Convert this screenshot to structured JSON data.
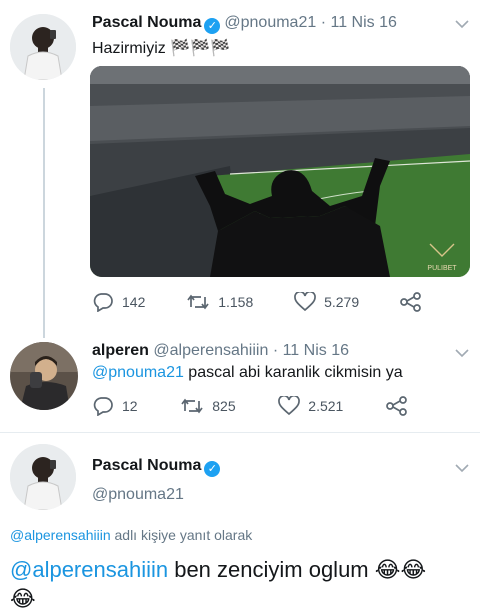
{
  "tweet1": {
    "name": "Pascal Nouma",
    "handle": "@pnouma21",
    "time": "· 11 Nis 16",
    "text": "Hazirmiyiz 🏁🏁🏁",
    "media_watermark": "PULIBET",
    "replies": "142",
    "retweets": "1.158",
    "likes": "5.279"
  },
  "tweet2": {
    "name": "alperen",
    "handle": "@alperensahiiin",
    "time": "· 11 Nis 16",
    "mention": "@pnouma21",
    "text": " pascal abi karanlik cikmisin ya",
    "replies": "12",
    "retweets": "825",
    "likes": "2.521"
  },
  "tweet3": {
    "name": "Pascal Nouma",
    "handle": "@pnouma21",
    "reply_to_handle": "@alperensahiiin",
    "reply_to_suffix": " adlı kişiye yanıt olarak",
    "mention": "@alperensahiiin",
    "text": " ben zenciyim oglum 😂😂",
    "text_line2": "😂"
  },
  "icons": {
    "verified": "verified-check-icon",
    "reply": "reply-icon",
    "retweet": "retweet-icon",
    "like": "heart-icon",
    "share": "share-icon",
    "more": "chevron-down-icon"
  },
  "colors": {
    "link": "#1b95e0",
    "verified": "#1da1f2",
    "muted": "#657786"
  }
}
